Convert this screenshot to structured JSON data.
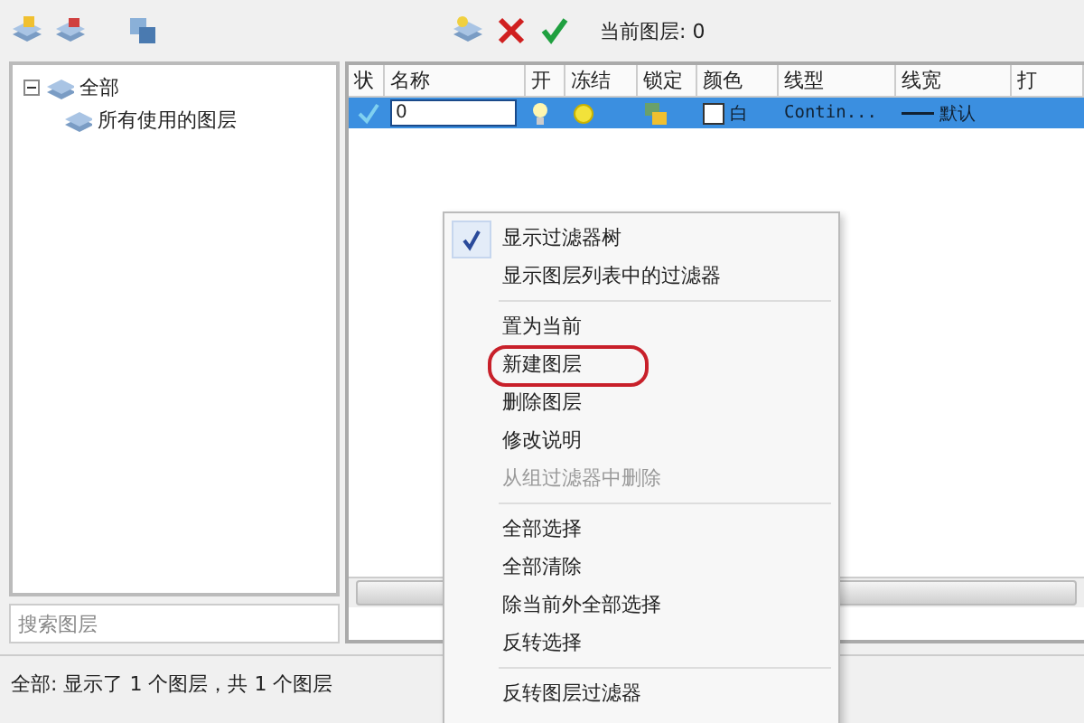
{
  "toolbar": {
    "current_layer_label": "当前图层: 0"
  },
  "tree": {
    "items": [
      {
        "label": "全部",
        "expanded": true,
        "children": [
          {
            "label": "所有使用的图层"
          }
        ]
      }
    ]
  },
  "search": {
    "placeholder": "搜索图层"
  },
  "table": {
    "columns": [
      "状",
      "名称",
      "开",
      "冻结",
      "锁定",
      "颜色",
      "线型",
      "线宽",
      "打"
    ],
    "rows": [
      {
        "selected": true,
        "cells": [
          {
            "kind": "status"
          },
          {
            "kind": "field",
            "text": "0"
          },
          {
            "kind": "bulb",
            "on": true
          },
          {
            "kind": "sun"
          },
          {
            "kind": "lock"
          },
          {
            "kind": "color",
            "text": "白"
          },
          {
            "kind": "text",
            "text": "Contin..."
          },
          {
            "kind": "lineweight",
            "text": "默认"
          },
          {
            "kind": "empty"
          }
        ]
      }
    ]
  },
  "status_bar": "全部: 显示了 1 个图层，共 1 个图层",
  "context_menu": {
    "groups": [
      [
        {
          "label": "显示过滤器树",
          "checked": true,
          "disabled": false,
          "circled": false
        },
        {
          "label": "显示图层列表中的过滤器",
          "checked": false,
          "disabled": false,
          "circled": false
        }
      ],
      [
        {
          "label": "置为当前",
          "checked": false,
          "disabled": false,
          "circled": false
        },
        {
          "label": "新建图层",
          "checked": false,
          "disabled": false,
          "circled": true
        },
        {
          "label": "删除图层",
          "checked": false,
          "disabled": false,
          "circled": false
        },
        {
          "label": "修改说明",
          "checked": false,
          "disabled": false,
          "circled": false
        },
        {
          "label": "从组过滤器中删除",
          "checked": false,
          "disabled": true,
          "circled": false
        }
      ],
      [
        {
          "label": "全部选择",
          "checked": false,
          "disabled": false,
          "circled": false
        },
        {
          "label": "全部清除",
          "checked": false,
          "disabled": false,
          "circled": false
        },
        {
          "label": "除当前外全部选择",
          "checked": false,
          "disabled": false,
          "circled": false
        },
        {
          "label": "反转选择",
          "checked": false,
          "disabled": false,
          "circled": false
        }
      ],
      [
        {
          "label": "反转图层过滤器",
          "checked": false,
          "disabled": false,
          "circled": false
        }
      ]
    ]
  }
}
